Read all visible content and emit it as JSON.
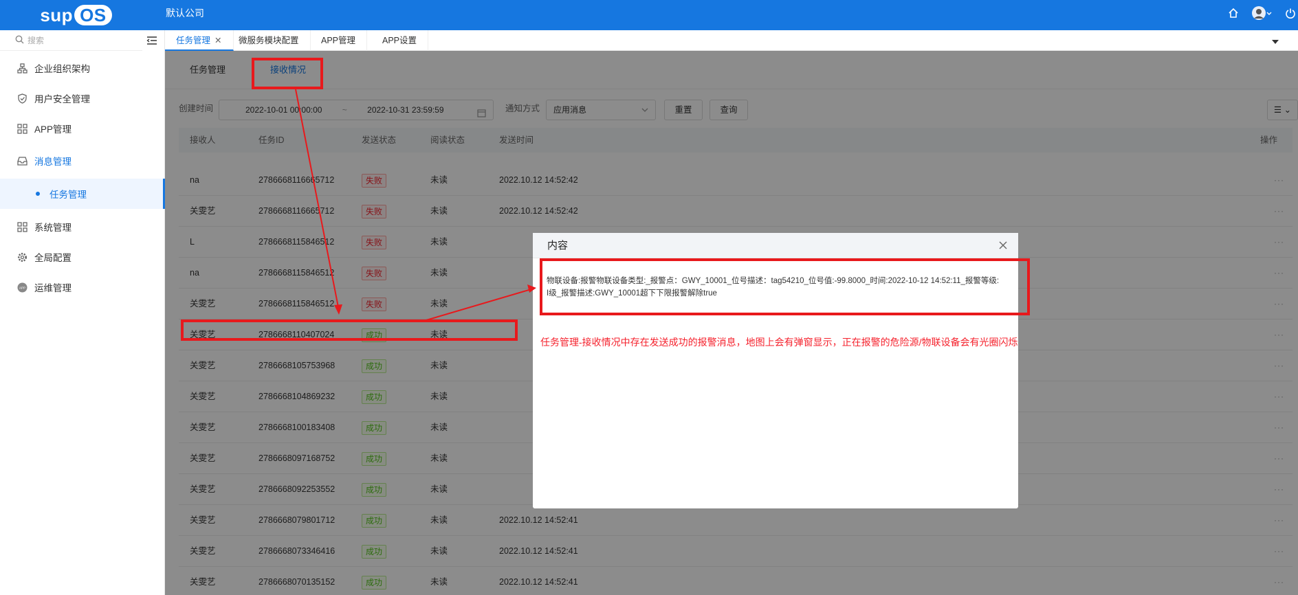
{
  "header": {
    "logo_text": "sup",
    "logo_os": "OS",
    "company": "默认公司",
    "icons": [
      "home-icon",
      "user-avatar-icon",
      "power-icon"
    ]
  },
  "sidebar": {
    "search_placeholder": "搜索",
    "items": [
      {
        "label": "企业组织架构",
        "icon": "org-tree-icon"
      },
      {
        "label": "用户安全管理",
        "icon": "shield-icon"
      },
      {
        "label": "APP管理",
        "icon": "grid-icon"
      },
      {
        "label": "消息管理",
        "icon": "inbox-icon"
      },
      {
        "label": "任务管理",
        "icon": "dot-icon"
      },
      {
        "label": "系统管理",
        "icon": "grid-icon"
      },
      {
        "label": "全局配置",
        "icon": "gear-icon"
      },
      {
        "label": "运维管理",
        "icon": "app-icon"
      }
    ]
  },
  "tabs": [
    {
      "label": "任务管理",
      "active": true
    },
    {
      "label": "微服务模块配置"
    },
    {
      "label": "APP管理"
    },
    {
      "label": "APP设置"
    }
  ],
  "subtabs": [
    {
      "label": "任务管理"
    },
    {
      "label": "接收情况",
      "active": true
    }
  ],
  "filter": {
    "created_label": "创建时间",
    "start": "2022-10-01 00:00:00",
    "sep": "~",
    "end": "2022-10-31 23:59:59",
    "notify_label": "通知方式",
    "notify_value": "应用消息",
    "reset": "重置",
    "query": "查询"
  },
  "table": {
    "columns": [
      "接收人",
      "任务ID",
      "发送状态",
      "阅读状态",
      "发送时间",
      "操作"
    ],
    "rows": [
      {
        "recipient": "na",
        "task_id": "2786668116665712",
        "status": "失败",
        "read": "未读",
        "time": "2022.10.12 14:52:42"
      },
      {
        "recipient": "关雯艺",
        "task_id": "2786668116665712",
        "status": "失败",
        "read": "未读",
        "time": "2022.10.12 14:52:42"
      },
      {
        "recipient": "L",
        "task_id": "2786668115846512",
        "status": "失败",
        "read": "未读",
        "time": ""
      },
      {
        "recipient": "na",
        "task_id": "2786668115846512",
        "status": "失败",
        "read": "未读",
        "time": ""
      },
      {
        "recipient": "关雯艺",
        "task_id": "2786668115846512",
        "status": "失败",
        "read": "未读",
        "time": ""
      },
      {
        "recipient": "关雯艺",
        "task_id": "2786668110407024",
        "status": "成功",
        "read": "未读",
        "time": ""
      },
      {
        "recipient": "关雯艺",
        "task_id": "2786668105753968",
        "status": "成功",
        "read": "未读",
        "time": ""
      },
      {
        "recipient": "关雯艺",
        "task_id": "2786668104869232",
        "status": "成功",
        "read": "未读",
        "time": ""
      },
      {
        "recipient": "关雯艺",
        "task_id": "2786668100183408",
        "status": "成功",
        "read": "未读",
        "time": ""
      },
      {
        "recipient": "关雯艺",
        "task_id": "2786668097168752",
        "status": "成功",
        "read": "未读",
        "time": ""
      },
      {
        "recipient": "关雯艺",
        "task_id": "2786668092253552",
        "status": "成功",
        "read": "未读",
        "time": ""
      },
      {
        "recipient": "关雯艺",
        "task_id": "2786668079801712",
        "status": "成功",
        "read": "未读",
        "time": "2022.10.12 14:52:41"
      },
      {
        "recipient": "关雯艺",
        "task_id": "2786668073346416",
        "status": "成功",
        "read": "未读",
        "time": "2022.10.12 14:52:41"
      },
      {
        "recipient": "关雯艺",
        "task_id": "2786668070135152",
        "status": "成功",
        "read": "未读",
        "time": "2022.10.12 14:52:41"
      }
    ],
    "ops_label": "···"
  },
  "modal": {
    "title": "内容",
    "line1": "物联设备:报警物联设备类型:_报警点：GWY_10001_位号描述：tag54210_位号值:-99.8000_时间:2022-10-12 14:52:11_报警等级:",
    "line2": "I级_报警描述:GWY_10001超下下限报警解除true"
  },
  "note": "任务管理-接收情况中存在发送成功的报警消息，地图上会有弹窗显示，正在报警的危险源/物联设备会有光圈闪烁",
  "colors": {
    "primary": "#1677e0",
    "annotation": "#e8191c",
    "fail": "#f5222d",
    "success": "#52c41a"
  }
}
